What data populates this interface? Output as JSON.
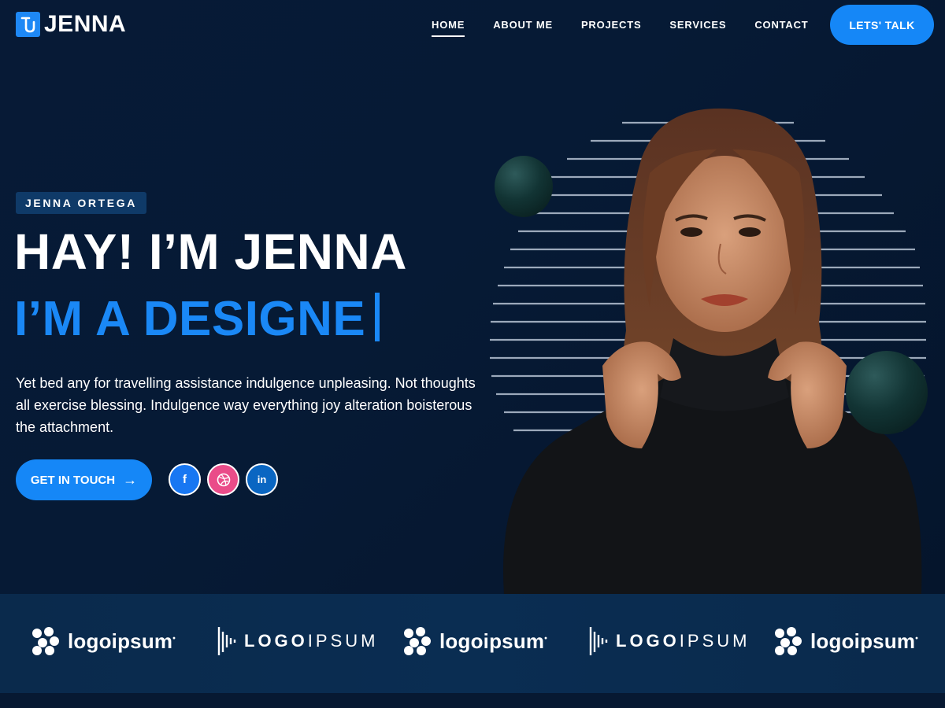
{
  "brand": {
    "name": "JENNA",
    "mark_color": "#1e88f5"
  },
  "nav": {
    "items": [
      {
        "label": "HOME",
        "active": true
      },
      {
        "label": "ABOUT ME",
        "active": false
      },
      {
        "label": "PROJECTS",
        "active": false
      },
      {
        "label": "SERVICES",
        "active": false
      },
      {
        "label": "CONTACT",
        "active": false
      }
    ],
    "cta_label": "LETS' TALK"
  },
  "hero": {
    "tag": "JENNA ORTEGA",
    "headline": "HAY! I’M JENNA",
    "subline": "I’M A DESIGNE",
    "description": "Yet bed any for travelling assistance indulgence unpleasing. Not thoughts all exercise blessing. Indulgence way everything joy alteration boisterous the attachment.",
    "button_label": "GET IN TOUCH",
    "button_icon": "arrow-right-icon",
    "socials": [
      {
        "name": "facebook-icon",
        "glyph": "f",
        "color": "#1877f2"
      },
      {
        "name": "dribbble-icon",
        "glyph": "◎",
        "color": "#ea4c89"
      },
      {
        "name": "linkedin-icon",
        "glyph": "in",
        "color": "#0a66c2"
      }
    ],
    "accent_color": "#1a88f6"
  },
  "logos": [
    {
      "style": "blob",
      "text": "logoipsum"
    },
    {
      "style": "bars",
      "text_bold": "LOGO",
      "text_light": "IPSUM"
    },
    {
      "style": "blob",
      "text": "logoipsum"
    },
    {
      "style": "bars",
      "text_bold": "LOGO",
      "text_light": "IPSUM"
    },
    {
      "style": "blob",
      "text": "logoipsum"
    }
  ]
}
